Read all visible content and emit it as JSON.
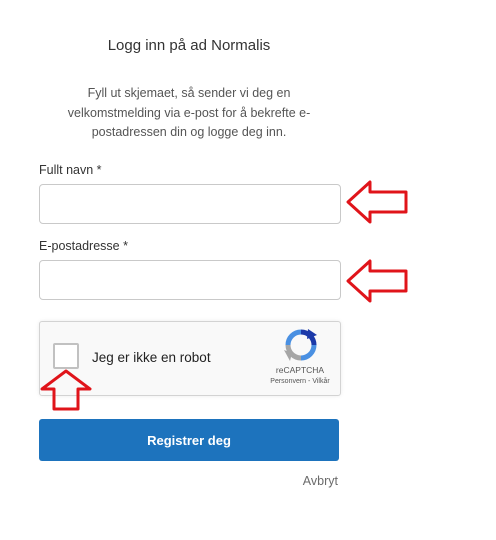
{
  "header": {
    "title": "Logg inn på ad Normalis",
    "intro": "Fyll ut skjemaet, så sender vi deg en velkomstmelding via e-post for å bekrefte e-postadressen din og logge deg inn."
  },
  "form": {
    "name_label": "Fullt navn *",
    "name_value": "",
    "email_label": "E-postadresse *",
    "email_value": ""
  },
  "captcha": {
    "label": "Jeg er ikke en robot",
    "brand": "reCAPTCHA",
    "privacy": "Personvern",
    "separator": " - ",
    "terms": "Vilkår",
    "checked": false
  },
  "actions": {
    "submit_label": "Registrer deg",
    "cancel_label": "Avbryt"
  },
  "colors": {
    "button": "#1d73bd",
    "annotation_arrow": "#e0141a"
  },
  "annotations": [
    "arrow-left-icon",
    "arrow-left-icon",
    "arrow-up-icon"
  ]
}
